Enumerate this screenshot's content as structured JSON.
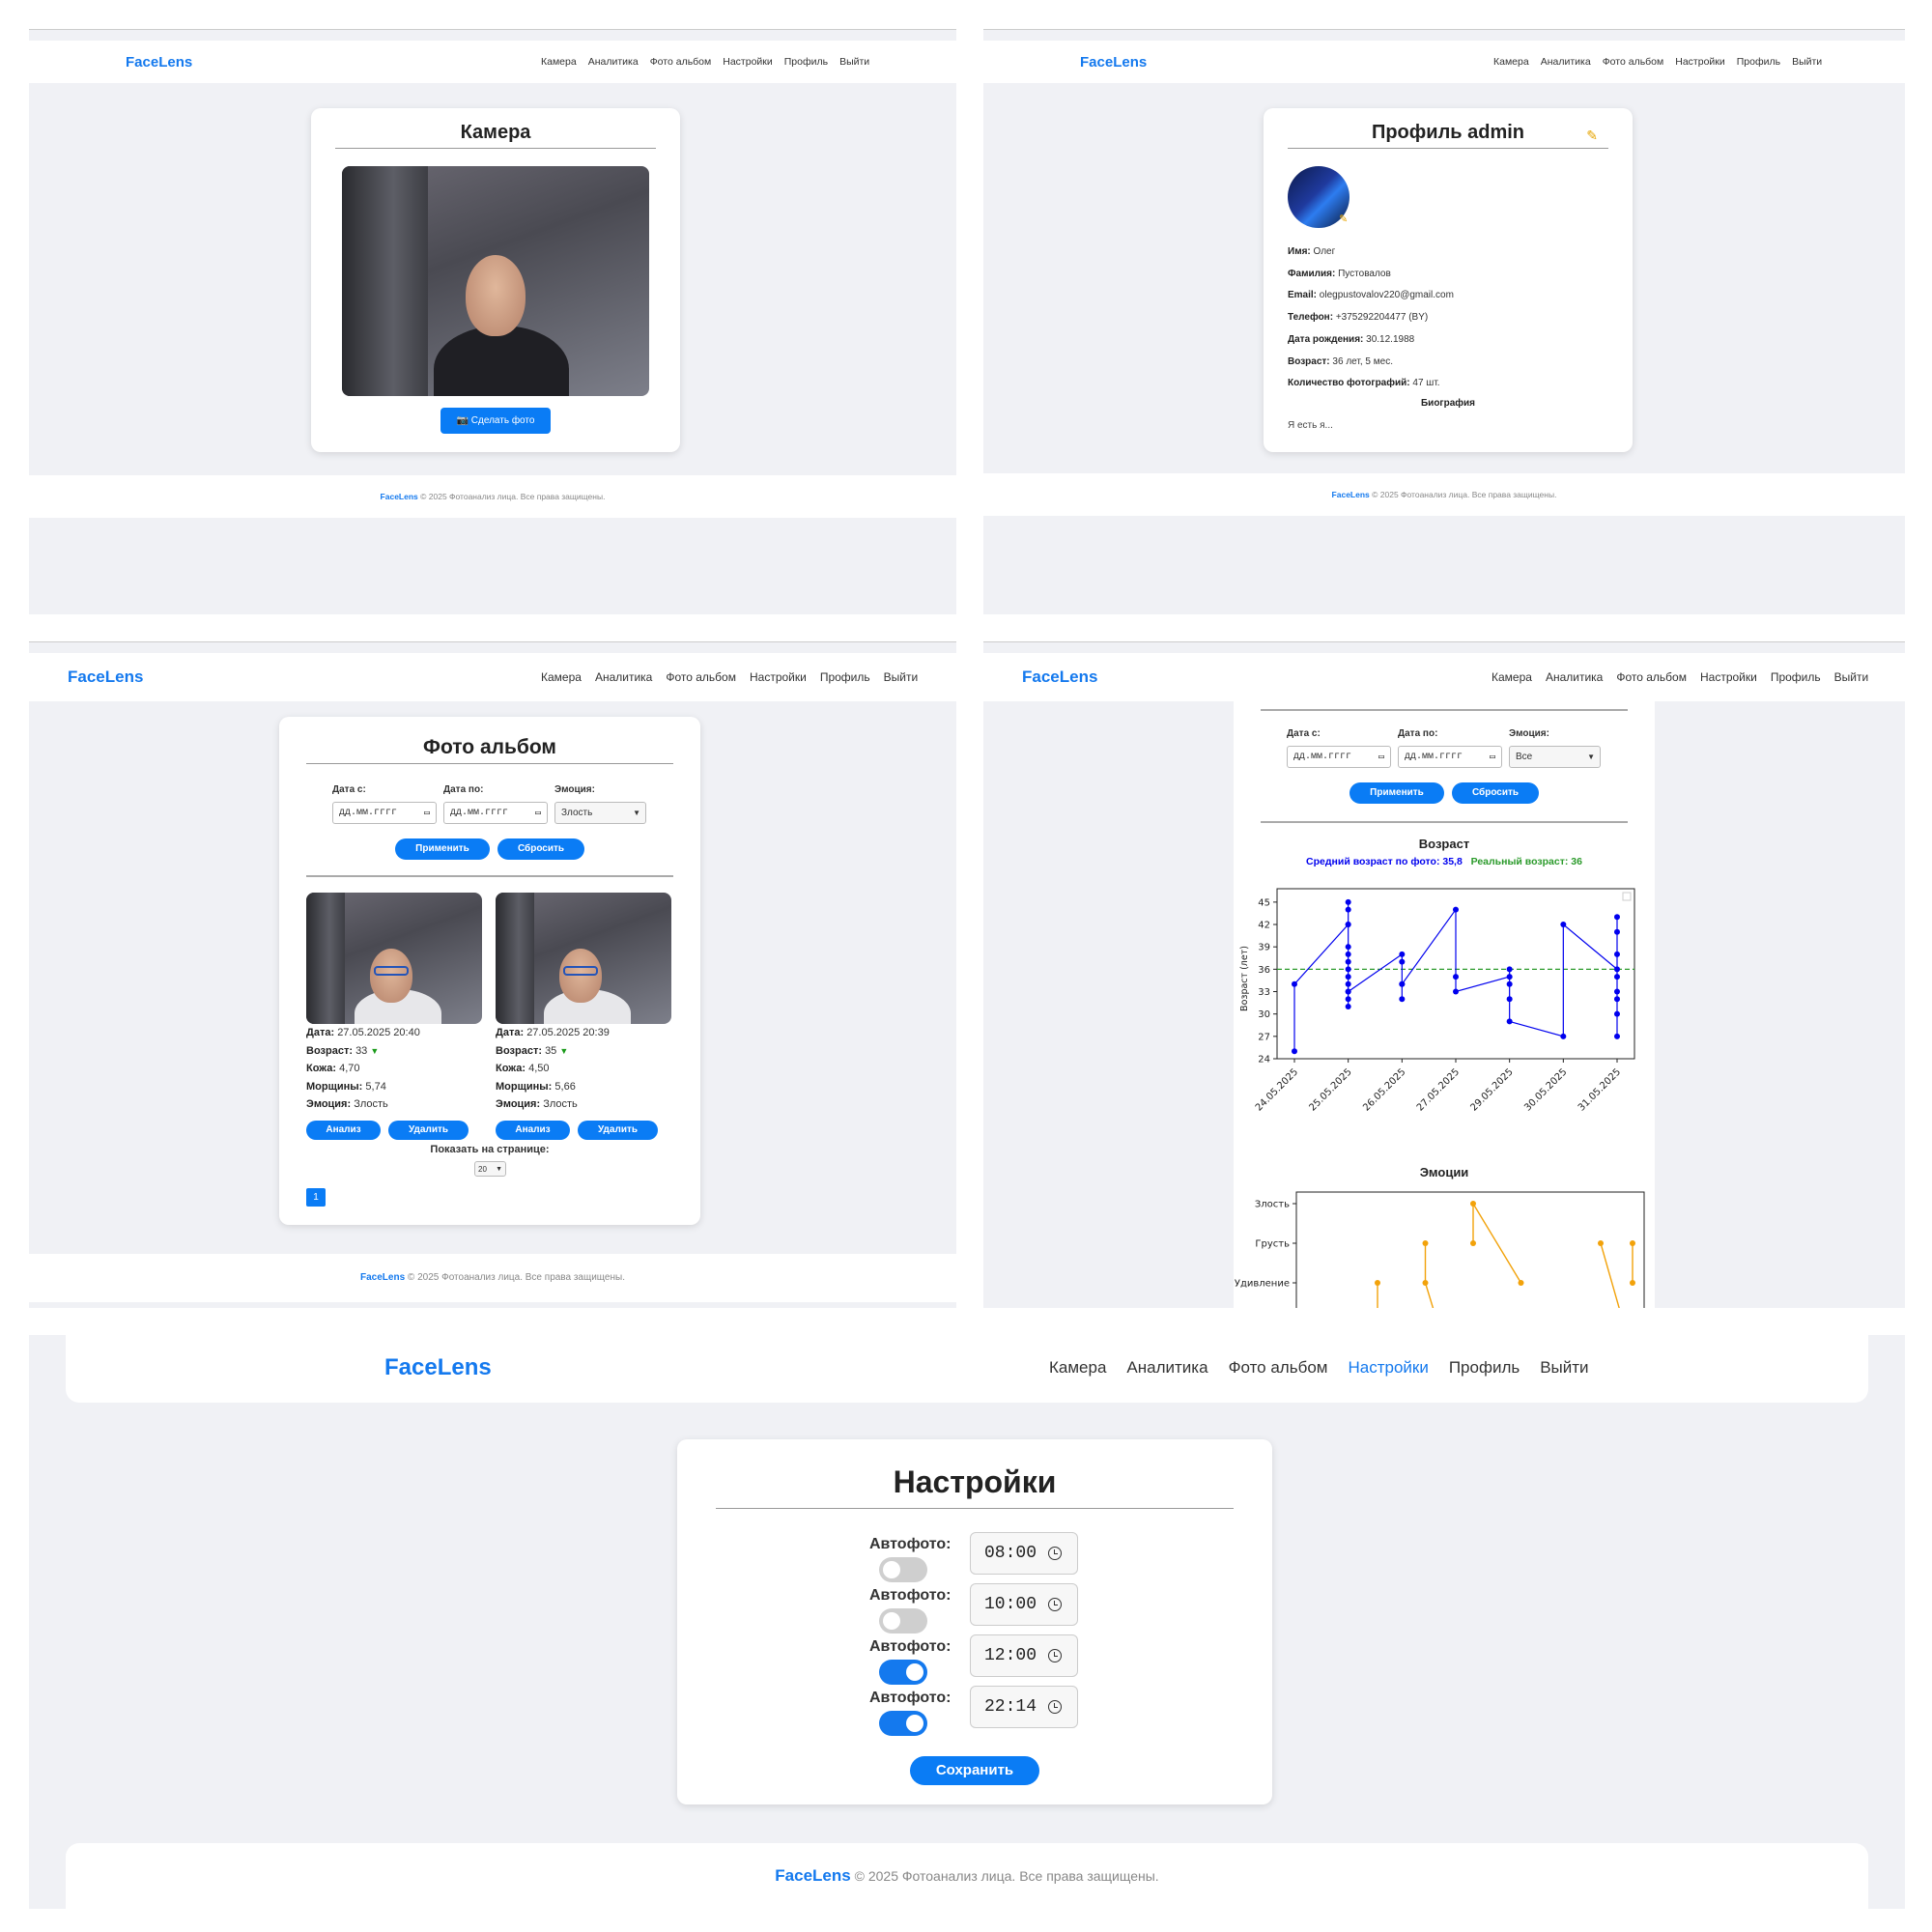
{
  "brand": "FaceLens",
  "nav": [
    "Камера",
    "Аналитика",
    "Фото альбом",
    "Настройки",
    "Профиль",
    "Выйти"
  ],
  "footer": {
    "brand": "FaceLens",
    "text": "© 2025 Фотоанализ лица. Все права защищены."
  },
  "camera": {
    "title": "Камера",
    "button": "📷 Сделать фото"
  },
  "profile": {
    "title": "Профиль admin",
    "edit_icon": "pencil-icon",
    "fields": [
      {
        "label": "Имя:",
        "value": "Олег"
      },
      {
        "label": "Фамилия:",
        "value": "Пустовалов"
      },
      {
        "label": "Email:",
        "value": "olegpustovalov220@gmail.com"
      },
      {
        "label": "Телефон:",
        "value": "+375292204477 (BY)"
      },
      {
        "label": "Дата рождения:",
        "value": "30.12.1988"
      },
      {
        "label": "Возраст:",
        "value": "36 лет, 5 мес."
      },
      {
        "label": "Количество фотографий:",
        "value": "47 шт."
      }
    ],
    "bio_title": "Биография",
    "bio": "Я есть я..."
  },
  "album": {
    "title": "Фото альбом",
    "filters": {
      "date_from_label": "Дата с:",
      "date_to_label": "Дата по:",
      "emotion_label": "Эмоция:",
      "date_placeholder": "дд.мм.гггг",
      "emotion_value": "Злость",
      "apply": "Применить",
      "reset": "Сбросить"
    },
    "photos": [
      {
        "date_label": "Дата:",
        "date": "27.05.2025 20:40",
        "age_label": "Возраст:",
        "age": "33",
        "arrow": "▼",
        "skin_label": "Кожа:",
        "skin": "4,70",
        "wrinkles_label": "Морщины:",
        "wrinkles": "5,74",
        "emotion_label": "Эмоция:",
        "emotion": "Злость",
        "analyze": "Анализ",
        "delete": "Удалить"
      },
      {
        "date_label": "Дата:",
        "date": "27.05.2025 20:39",
        "age_label": "Возраст:",
        "age": "35",
        "arrow": "▼",
        "skin_label": "Кожа:",
        "skin": "4,50",
        "wrinkles_label": "Морщины:",
        "wrinkles": "5,66",
        "emotion_label": "Эмоция:",
        "emotion": "Злость",
        "analyze": "Анализ",
        "delete": "Удалить"
      }
    ],
    "per_page_label": "Показать на странице:",
    "per_page_value": "20",
    "page": "1"
  },
  "analytics": {
    "filters": {
      "date_from_label": "Дата с:",
      "date_to_label": "Дата по:",
      "emotion_label": "Эмоция:",
      "date_placeholder": "дд.мм.гггг",
      "emotion_value": "Все",
      "apply": "Применить",
      "reset": "Сбросить"
    },
    "age_title": "Возраст",
    "avg_text": "Средний возраст по фото: 35,8",
    "real_text": "Реальный возраст: 36",
    "emotions_title": "Эмоции"
  },
  "chart_data": [
    {
      "type": "line",
      "title": "Возраст",
      "ylabel": "Возраст (лет)",
      "xlabel": "",
      "categories": [
        "24.05.2025",
        "25.05.2025",
        "26.05.2025",
        "27.05.2025",
        "29.05.2025",
        "30.05.2025",
        "31.05.2025"
      ],
      "yticks": [
        24,
        27,
        30,
        33,
        36,
        39,
        42,
        45
      ],
      "ylim": [
        24,
        45.5
      ],
      "series": [
        {
          "color": "#0000ee",
          "points": [
            [
              0,
              25
            ],
            [
              0,
              34
            ],
            [
              1,
              42
            ],
            [
              1,
              45
            ],
            [
              1,
              44
            ],
            [
              1,
              42
            ],
            [
              1,
              39
            ],
            [
              1,
              38
            ],
            [
              1,
              37
            ],
            [
              1,
              36
            ],
            [
              1,
              35
            ],
            [
              1,
              34
            ],
            [
              1,
              33
            ],
            [
              1,
              32
            ],
            [
              1,
              31
            ],
            [
              1,
              33
            ],
            [
              2,
              38
            ],
            [
              2,
              37
            ],
            [
              2,
              34
            ],
            [
              2,
              32
            ],
            [
              2,
              34
            ],
            [
              3,
              44
            ],
            [
              3,
              35
            ],
            [
              3,
              33
            ],
            [
              4,
              35
            ],
            [
              4,
              36
            ],
            [
              4,
              34
            ],
            [
              4,
              32
            ],
            [
              4,
              29
            ],
            [
              5,
              27
            ],
            [
              5,
              42
            ],
            [
              6,
              36
            ],
            [
              6,
              43
            ],
            [
              6,
              41
            ],
            [
              6,
              38
            ],
            [
              6,
              35
            ],
            [
              6,
              33
            ],
            [
              6,
              32
            ],
            [
              6,
              30
            ],
            [
              6,
              27
            ]
          ]
        }
      ],
      "reference_line": {
        "value": 36,
        "color": "#2a9a2a",
        "style": "dashed"
      },
      "grid": false
    },
    {
      "type": "line",
      "title": "Эмоции",
      "categories_y": [
        "Злость",
        "Грусть",
        "Удивление"
      ],
      "series": [
        {
          "color": "#f2a20a",
          "segments": [
            [
              [
                1.2,
                "Удивление"
              ],
              [
                1.2,
                "Удивление_low"
              ]
            ],
            [
              [
                2.1,
                "Грусть"
              ],
              [
                2.1,
                "Удивление"
              ],
              [
                2.3,
                "below"
              ]
            ],
            [
              [
                3.0,
                "Грусть"
              ],
              [
                3.0,
                "Злость"
              ],
              [
                3.9,
                "Удивление"
              ]
            ],
            [
              [
                5.4,
                "Грусть"
              ],
              [
                5.8,
                "below"
              ]
            ],
            [
              [
                6.0,
                "Грусть"
              ],
              [
                6.0,
                "Удивление"
              ]
            ]
          ]
        }
      ]
    }
  ],
  "settings": {
    "title": "Настройки",
    "rows": [
      {
        "label": "Автофото:",
        "time": "08:00",
        "on": false
      },
      {
        "label": "Автофото:",
        "time": "10:00",
        "on": false
      },
      {
        "label": "Автофото:",
        "time": "12:00",
        "on": true
      },
      {
        "label": "Автофото:",
        "time": "22:14",
        "on": true
      }
    ],
    "save": "Сохранить",
    "active_nav": "Настройки"
  },
  "colors": {
    "accent": "#1479ee",
    "button": "#0a7cf5",
    "bg": "#f0f1f5",
    "age_series": "#0000ee",
    "real_age": "#2a9a2a",
    "emotion_series": "#f2a20a"
  }
}
